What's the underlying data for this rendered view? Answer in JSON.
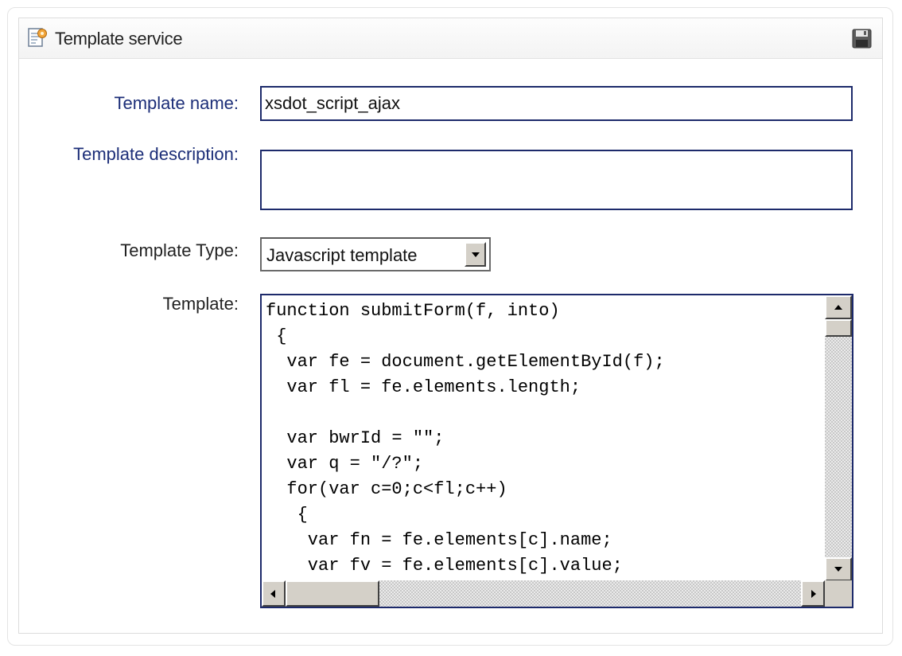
{
  "panel": {
    "title": "Template service"
  },
  "icons": {
    "title": "template-document-icon",
    "save": "floppy-disk-save-icon"
  },
  "form": {
    "name_label": "Template name:",
    "name_value": "xsdot_script_ajax",
    "description_label": "Template description:",
    "description_value": "",
    "type_label": "Template Type:",
    "type_selected": "Javascript template",
    "template_label": "Template:",
    "template_lines": [
      "function submitForm(f, into)",
      " {",
      "  var fe = document.getElementById(f);",
      "  var fl = fe.elements.length;",
      "",
      "  var bwrId = \"\";",
      "  var q = \"/?\";",
      "  for(var c=0;c<fl;c++)",
      "   {",
      "    var fn = fe.elements[c].name;",
      "    var fv = fe.elements[c].value;"
    ]
  },
  "colors": {
    "label_blue": "#1c2e78",
    "field_border": "#1d2a6b",
    "scrollbar_face": "#d4d0c8"
  }
}
